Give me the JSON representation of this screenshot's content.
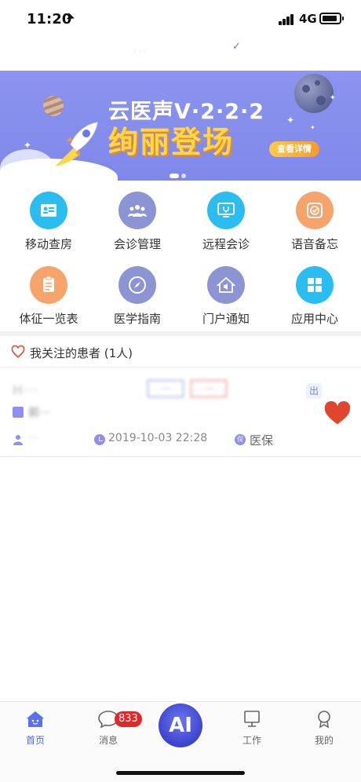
{
  "status_bar": {
    "time": "11:20",
    "network": "4G"
  },
  "header": {
    "title": "..."
  },
  "banner": {
    "headline": "云医声V·2·2·2",
    "slogan": "绚丽登场",
    "button_label": "查看详情"
  },
  "grid": {
    "items": [
      {
        "label": "移动查房",
        "icon": "mobile-rounds-icon",
        "color": "#2bbcf0"
      },
      {
        "label": "会诊管理",
        "icon": "consult-manage-icon",
        "color": "#8c94d4"
      },
      {
        "label": "远程会诊",
        "icon": "remote-consult-icon",
        "color": "#2bbcf0"
      },
      {
        "label": "语音备忘",
        "icon": "voice-memo-icon",
        "color": "#f7a36c"
      },
      {
        "label": "体征一览表",
        "icon": "vital-signs-icon",
        "color": "#f7a36c"
      },
      {
        "label": "医学指南",
        "icon": "compass-icon",
        "color": "#8c94d4"
      },
      {
        "label": "门户通知",
        "icon": "portal-notice-icon",
        "color": "#8c94d4"
      },
      {
        "label": "应用中心",
        "icon": "app-center-icon",
        "color": "#2bbcf0"
      }
    ]
  },
  "follow": {
    "title": "我关注的患者 (1人)",
    "patient": {
      "name": "H···",
      "tag_blue": "···",
      "tag_red": "···",
      "status": "出",
      "diagnosis": "前···",
      "doctor": "···",
      "admit_time": "2019-10-03 22:28",
      "insurance": "医保",
      "insurance_icon_text": "保"
    }
  },
  "tabbar": {
    "tabs": [
      {
        "label": "首页",
        "icon": "home-icon"
      },
      {
        "label": "消息",
        "icon": "message-icon"
      },
      {
        "label": "工作",
        "icon": "work-icon"
      },
      {
        "label": "我的",
        "icon": "profile-icon"
      }
    ],
    "message_badge": "833",
    "ai_label": "AI"
  },
  "colors": {
    "accent": "#4f6ae8",
    "heart": "#e0452e",
    "banner": "#8c94ee"
  }
}
